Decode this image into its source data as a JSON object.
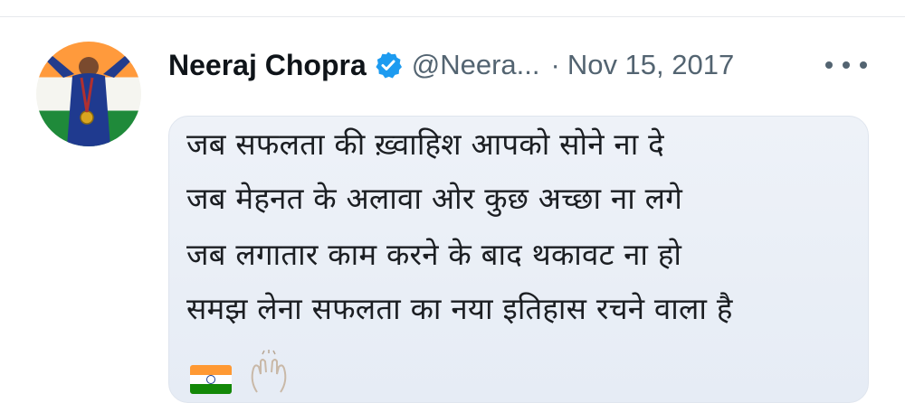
{
  "tweet": {
    "author_name": "Neeraj Chopra",
    "verified": true,
    "handle": "@Neera...",
    "separator": "·",
    "date": "Nov 15, 2017",
    "more_label": "•••",
    "body_lines": [
      "जब सफलता की ख़्वाहिश आपको सोने ना दे",
      "जब मेहनत के अलावा ओर कुछ अच्छा ना लगे",
      "जब लगातार काम करने के बाद थकावट ना हो",
      "समझ लेना सफलता का नया इतिहास रचने वाला है"
    ],
    "emojis": [
      "india-flag",
      "clapping-hands"
    ]
  },
  "colors": {
    "name": "#0f1419",
    "meta": "#536471",
    "verified_blue": "#1d9bf0",
    "bubble_bg": "#eef2f8",
    "flag_saffron": "#ff9933",
    "flag_green": "#138808"
  }
}
